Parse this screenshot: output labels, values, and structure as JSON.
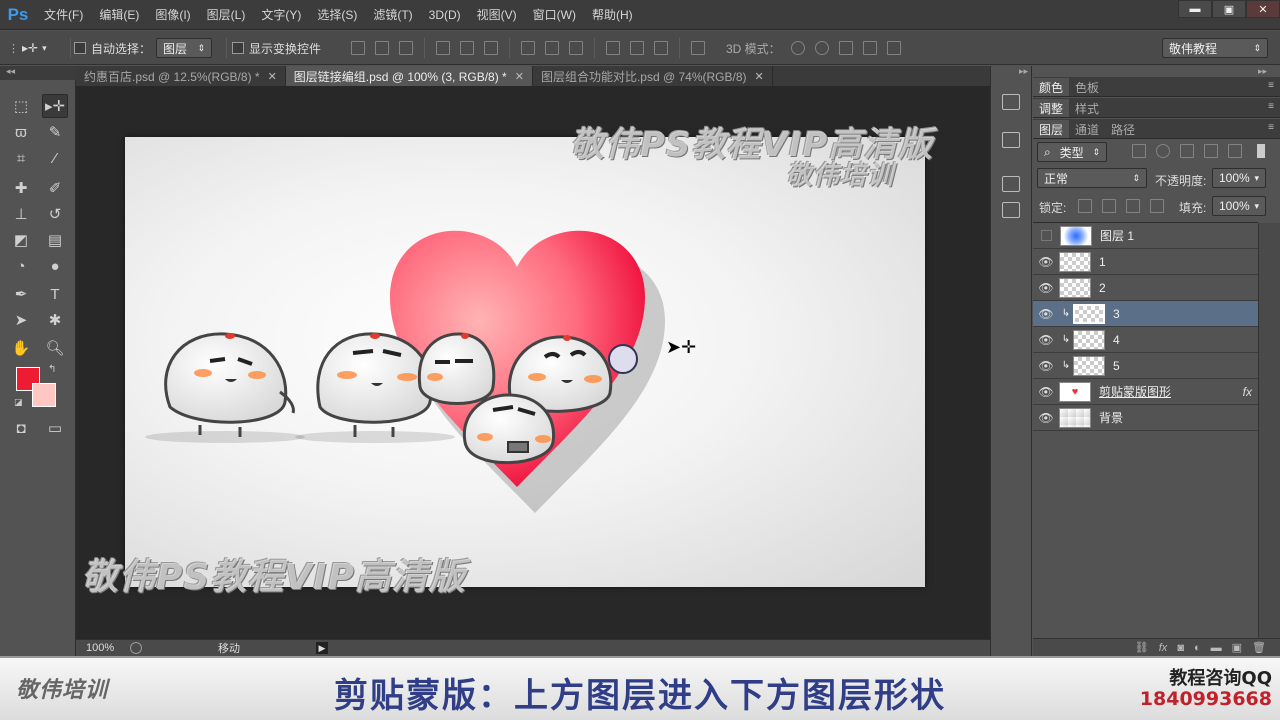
{
  "app": {
    "logo": "Ps"
  },
  "menu": [
    "文件(F)",
    "编辑(E)",
    "图像(I)",
    "图层(L)",
    "文字(Y)",
    "选择(S)",
    "滤镜(T)",
    "3D(D)",
    "视图(V)",
    "窗口(W)",
    "帮助(H)"
  ],
  "window_controls": {
    "minimize": "▬",
    "maximize": "▣",
    "close": "✕"
  },
  "options": {
    "move_icon": "▸✛",
    "auto_select_label": "自动选择：",
    "auto_select_value": "图层",
    "show_transform_label": "显示变换控件",
    "mode_3d_label": "3D 模式：",
    "workspace": "敬伟教程"
  },
  "tabs": [
    {
      "label": "约惠百店.psd @ 12.5%(RGB/8) *",
      "active": false
    },
    {
      "label": "图层链接编组.psd @ 100% (3, RGB/8) *",
      "active": true
    },
    {
      "label": "图层组合功能对比.psd @ 74%(RGB/8)",
      "active": false
    }
  ],
  "status": {
    "zoom": "100%",
    "tool": "移动"
  },
  "watermarks": {
    "top_line1": "敬伟PS教程VIP高清版",
    "top_line2": "敬伟培训",
    "bottom": "敬伟PS教程VIP高清版"
  },
  "colors": {
    "foreground": "#ee1c33",
    "background": "#ffc7c2",
    "accent": "#3d9ae8",
    "banner_title": "#2f3e86",
    "qq_num": "#c0212b"
  },
  "panels": {
    "top_tabs": [
      "颜色",
      "色板"
    ],
    "mid_tabs": [
      "调整",
      "样式"
    ],
    "layer_tabs": [
      "图层",
      "通道",
      "路径"
    ],
    "filter_type": "类型",
    "blend_mode": "正常",
    "opacity_label": "不透明度:",
    "opacity_value": "100%",
    "lock_label": "锁定:",
    "fill_label": "填充:",
    "fill_value": "100%"
  },
  "layers": [
    {
      "name": "图层 1",
      "visible": false,
      "clipped": false,
      "thumb": "blue-blob",
      "active": false
    },
    {
      "name": "1",
      "visible": true,
      "clipped": false,
      "thumb": "transparent",
      "active": false
    },
    {
      "name": "2",
      "visible": true,
      "clipped": false,
      "thumb": "transparent",
      "active": false
    },
    {
      "name": "3",
      "visible": true,
      "clipped": true,
      "thumb": "transparent",
      "active": true
    },
    {
      "name": "4",
      "visible": true,
      "clipped": true,
      "thumb": "transparent",
      "active": false
    },
    {
      "name": "5",
      "visible": true,
      "clipped": true,
      "thumb": "transparent",
      "active": false
    },
    {
      "name": "剪贴蒙版图形",
      "visible": true,
      "clipped": false,
      "thumb": "heart",
      "active": false,
      "fx": "fx"
    },
    {
      "name": "背景",
      "visible": true,
      "clipped": false,
      "thumb": "bg",
      "active": false
    }
  ],
  "banner": {
    "logo": "敬伟培训",
    "title": "剪贴蒙版：上方图层进入下方图层形状",
    "qq_label": "教程咨询QQ",
    "qq_number": "1840993668"
  }
}
